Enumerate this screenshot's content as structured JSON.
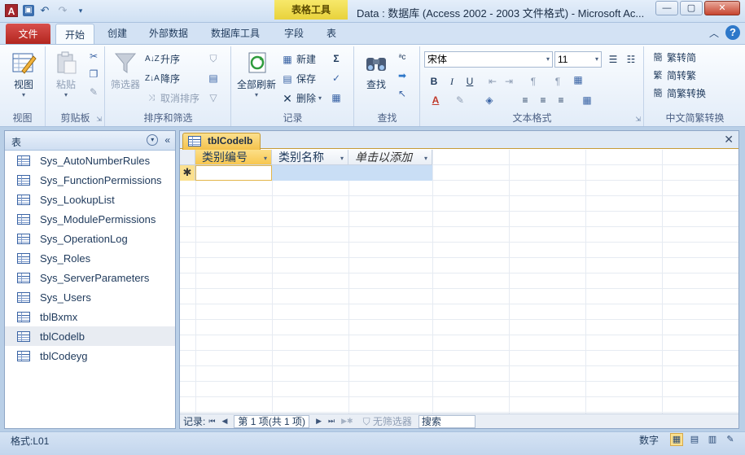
{
  "window": {
    "app_icon": "A",
    "context_tab": "表格工具",
    "title": "Data : 数据库 (Access 2002 - 2003 文件格式) - Microsoft Ac...",
    "buttons": [
      "minimize",
      "maximize",
      "close"
    ]
  },
  "ribbon_tabs": {
    "file": "文件",
    "home": "开始",
    "create": "创建",
    "external": "外部数据",
    "dbtools": "数据库工具",
    "fields": "字段",
    "table": "表"
  },
  "ribbon": {
    "view": {
      "label": "视图",
      "group": "视图"
    },
    "clipboard": {
      "paste": "粘贴",
      "group": "剪贴板"
    },
    "sort": {
      "filter": "筛选器",
      "asc": "升序",
      "desc": "降序",
      "clear": "取消排序",
      "group": "排序和筛选"
    },
    "records": {
      "refresh": "全部刷新",
      "new": "新建",
      "save": "保存",
      "delete": "删除",
      "group": "记录"
    },
    "find": {
      "find": "查找",
      "group": "查找"
    },
    "text": {
      "font": "宋体",
      "size": "11",
      "group": "文本格式"
    },
    "chinese": {
      "t2s": "繁转简",
      "s2t": "简转繁",
      "convert": "简繁转换",
      "group": "中文简繁转换"
    }
  },
  "nav": {
    "header": "表",
    "items": [
      "Sys_AutoNumberRules",
      "Sys_FunctionPermissions",
      "Sys_LookupList",
      "Sys_ModulePermissions",
      "Sys_OperationLog",
      "Sys_Roles",
      "Sys_ServerParameters",
      "Sys_Users",
      "tblBxmx",
      "tblCodelb",
      "tblCodeyg"
    ],
    "selected": "tblCodelb"
  },
  "document": {
    "tab": "tblCodelb",
    "columns": [
      "类别编号",
      "类别名称",
      "单击以添加"
    ],
    "new_row_marker": "✱"
  },
  "record_nav": {
    "label": "记录:",
    "position": "第 1 项(共 1 项)",
    "filter": "无筛选器",
    "search": "搜索"
  },
  "status": {
    "left": "格式:L01",
    "right": "数字"
  }
}
